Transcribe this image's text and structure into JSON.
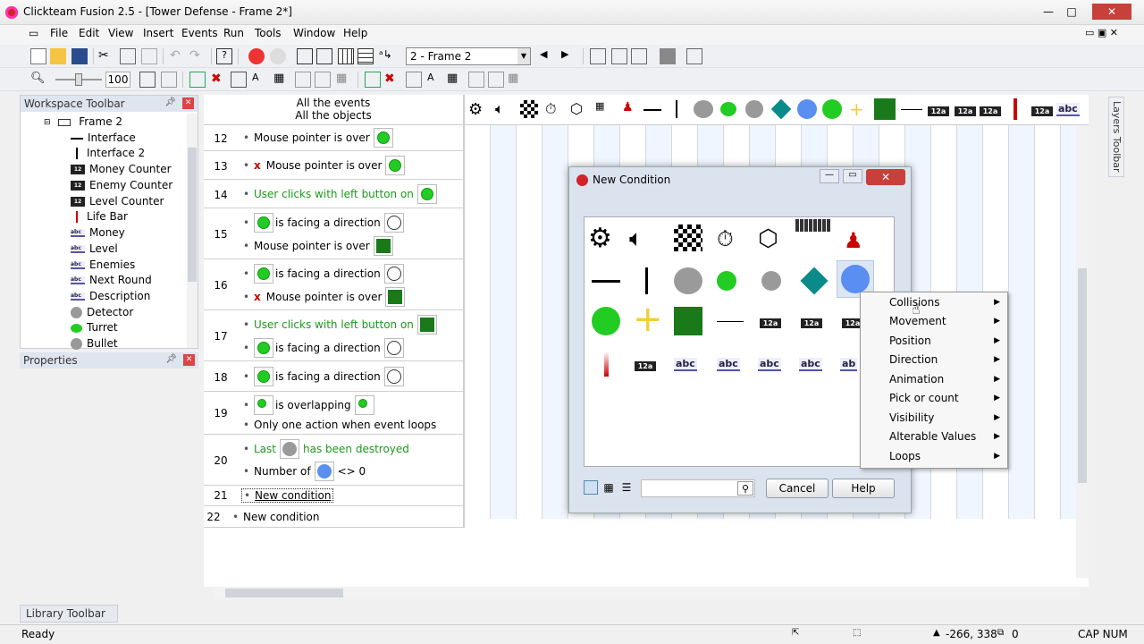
{
  "window": {
    "title": "Clickteam Fusion 2.5 - [Tower Defense - Frame 2*]",
    "min": "—",
    "max": "□",
    "close": "✕"
  },
  "menu": [
    "File",
    "Edit",
    "View",
    "Insert",
    "Events",
    "Run",
    "Tools",
    "Window",
    "Help"
  ],
  "toolbar": {
    "frame_select": "2 - Frame 2",
    "zoom_value": "100"
  },
  "workspace": {
    "title": "Workspace Toolbar",
    "root": "Frame 2",
    "items": [
      "Interface",
      "Interface 2",
      "Money Counter",
      "Enemy Counter",
      "Level Counter",
      "Life Bar",
      "Money",
      "Level",
      "Enemies",
      "Next Round",
      "Description",
      "Detector",
      "Turret",
      "Bullet"
    ]
  },
  "properties": {
    "title": "Properties"
  },
  "library": {
    "title": "Library Toolbar"
  },
  "layers": {
    "title": "Layers Toolbar"
  },
  "events": {
    "header1": "All the events",
    "header2": "All the objects",
    "rows": [
      {
        "num": "12",
        "c1": "Mouse pointer is over"
      },
      {
        "num": "13",
        "c1": "Mouse pointer is over"
      },
      {
        "num": "14",
        "c1": "User clicks with left button on"
      },
      {
        "num": "15",
        "c1": "is facing a direction",
        "c2": "Mouse pointer is over"
      },
      {
        "num": "16",
        "c1": "is facing a direction",
        "c2": "Mouse pointer is over"
      },
      {
        "num": "17",
        "c1": "User clicks with left button on",
        "c2": "is facing a direction"
      },
      {
        "num": "18",
        "c1": "is facing a direction"
      },
      {
        "num": "19",
        "c1": "is overlapping",
        "c2": "Only one action when event loops"
      },
      {
        "num": "20",
        "c1": "Last",
        "c1b": "has been destroyed",
        "c2": "Number of",
        "c2b": "<> 0"
      },
      {
        "num": "21",
        "c1": "New condition"
      },
      {
        "num": "22",
        "c1": "New condition"
      }
    ]
  },
  "dialog": {
    "title": "New Condition",
    "cancel": "Cancel",
    "help": "Help",
    "abc": "abc",
    "abc_cut": "ab",
    "counter": "12a"
  },
  "context_menu": [
    "Collisions",
    "Movement",
    "Position",
    "Direction",
    "Animation",
    "Pick or count",
    "Visibility",
    "Alterable Values",
    "Loops"
  ],
  "status": {
    "left": "Ready",
    "coords": "-266, 338",
    "objects": "0",
    "caps": "CAP NUM"
  },
  "colors": {
    "accent_red": "#d2232a",
    "green": "#22cc22",
    "blue_obj": "#5a8ef0"
  }
}
